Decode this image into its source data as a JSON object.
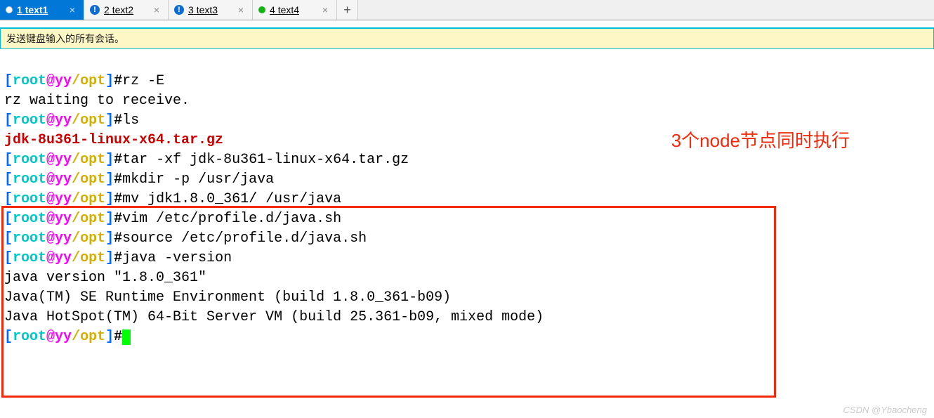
{
  "tabs": {
    "items": [
      {
        "num": "1",
        "label": "text1",
        "active": true,
        "icon": "green-dot"
      },
      {
        "num": "2",
        "label": "text2",
        "active": false,
        "icon": "blue-ex"
      },
      {
        "num": "3",
        "label": "text3",
        "active": false,
        "icon": "blue-ex"
      },
      {
        "num": "4",
        "label": "text4",
        "active": false,
        "icon": "green-dot"
      }
    ],
    "add": "+"
  },
  "infobar": "发送键盘输入的所有会话。",
  "prompt": {
    "lb": "[",
    "user": "root",
    "at": "@",
    "host": "yy",
    "path": "/opt",
    "rb": "]",
    "hash": "#"
  },
  "lines": {
    "l1_cmd": "rz -E",
    "l2": "rz waiting to receive.",
    "l3_cmd": "ls",
    "l4_file": "jdk-8u361-linux-x64.tar.gz",
    "l5_cmd": "tar -xf jdk-8u361-linux-x64.tar.gz",
    "l6_cmd": "mkdir -p /usr/java",
    "l7_cmd": "mv jdk1.8.0_361/ /usr/java",
    "l8_cmd": "vim /etc/profile.d/java.sh",
    "l9_cmd": "source /etc/profile.d/java.sh",
    "l10_cmd": "java -version",
    "l11": "java version \"1.8.0_361\"",
    "l12": "Java(TM) SE Runtime Environment (build 1.8.0_361-b09)",
    "l13": "Java HotSpot(TM) 64-Bit Server VM (build 25.361-b09, mixed mode)"
  },
  "annotation": "3个node节点同时执行",
  "watermark": "CSDN @Ybaocheng"
}
